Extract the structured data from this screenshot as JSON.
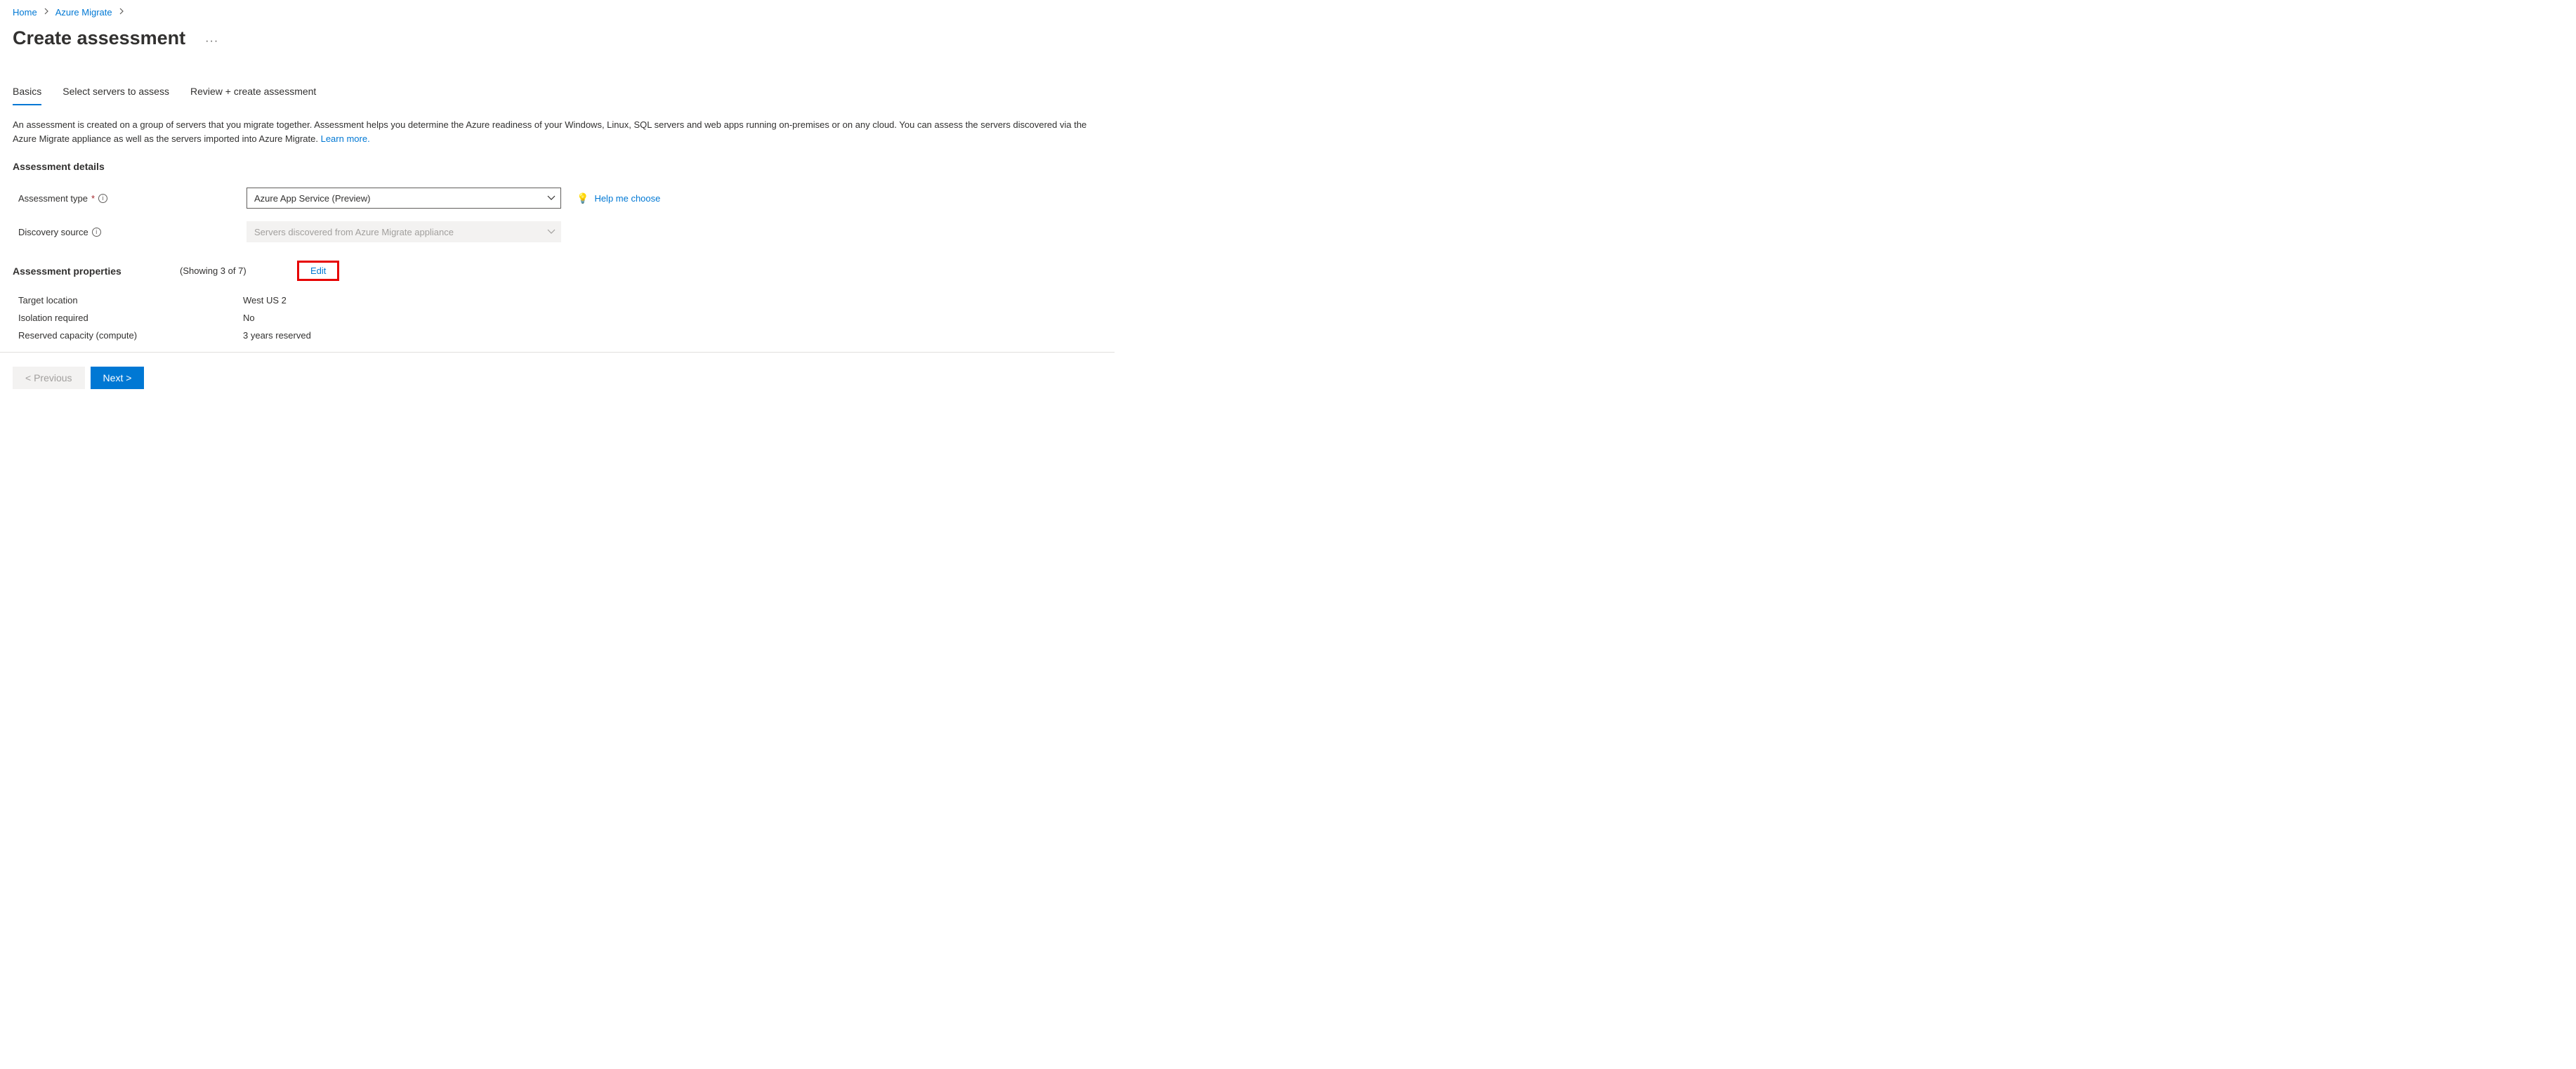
{
  "breadcrumb": {
    "home": "Home",
    "service": "Azure Migrate"
  },
  "title": "Create assessment",
  "tabs": {
    "basics": "Basics",
    "select_servers": "Select servers to assess",
    "review": "Review + create assessment"
  },
  "description": {
    "text": "An assessment is created on a group of servers that you migrate together. Assessment helps you determine the Azure readiness of your Windows, Linux, SQL servers and web apps running on-premises or on any cloud. You can assess the servers discovered via the Azure Migrate appliance as well as the servers imported into Azure Migrate. ",
    "learn_more": "Learn more."
  },
  "section_details_header": "Assessment details",
  "form": {
    "assessment_type_label": "Assessment type",
    "assessment_type_value": "Azure App Service (Preview)",
    "discovery_source_label": "Discovery source",
    "discovery_source_value": "Servers discovered from Azure Migrate appliance",
    "help_me_choose": "Help me choose"
  },
  "props": {
    "header": "Assessment properties",
    "showing": "(Showing 3 of 7)",
    "edit": "Edit",
    "rows": [
      {
        "label": "Target location",
        "value": "West US 2"
      },
      {
        "label": "Isolation required",
        "value": "No"
      },
      {
        "label": "Reserved capacity (compute)",
        "value": "3 years reserved"
      }
    ]
  },
  "footer": {
    "previous": "< Previous",
    "next": "Next >"
  }
}
